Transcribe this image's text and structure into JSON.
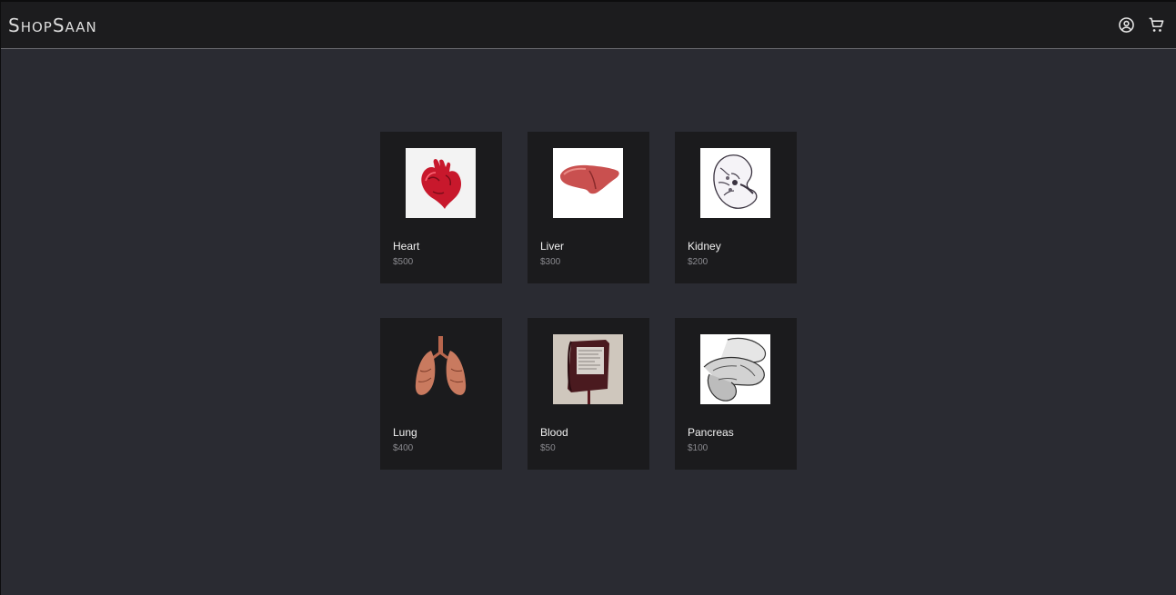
{
  "header": {
    "brand_prefix": "S",
    "brand_part1": "HOP",
    "brand_s2": "S",
    "brand_part2": "AAN",
    "account_icon": "account-circle-icon",
    "cart_icon": "shopping-cart-icon"
  },
  "products": [
    {
      "name": "Heart",
      "price": "$500"
    },
    {
      "name": "Liver",
      "price": "$300"
    },
    {
      "name": "Kidney",
      "price": "$200"
    },
    {
      "name": "Lung",
      "price": "$400"
    },
    {
      "name": "Blood",
      "price": "$50"
    },
    {
      "name": "Pancreas",
      "price": "$100"
    }
  ],
  "colors": {
    "background": "#2a2b32",
    "header": "#1c1c1e",
    "card": "#1b1b1d",
    "price": "#8a8a8f"
  }
}
